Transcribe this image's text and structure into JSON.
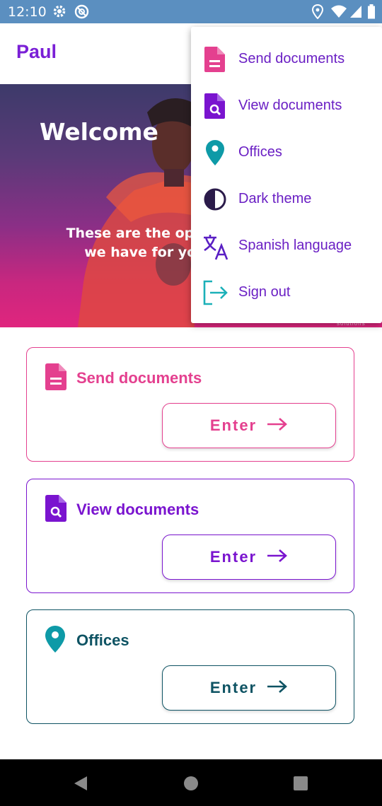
{
  "status_bar": {
    "time": "12:10"
  },
  "app_bar": {
    "user_name": "Paul"
  },
  "hero": {
    "welcome": "Welcome",
    "tagline_line1": "These are the option",
    "tagline_line2": "we have for you",
    "watermark": "solutions"
  },
  "cards": [
    {
      "title": "Send documents",
      "button": "Enter",
      "color": "#e4408f",
      "icon": "document-icon"
    },
    {
      "title": "View documents",
      "button": "Enter",
      "color": "#7a14cf",
      "icon": "document-search-icon"
    },
    {
      "title": "Offices",
      "button": "Enter",
      "color": "#0e5363",
      "icon": "location-pin-icon"
    }
  ],
  "menu": {
    "items": [
      {
        "label": "Send documents",
        "icon": "document-icon"
      },
      {
        "label": "View documents",
        "icon": "document-search-icon"
      },
      {
        "label": "Offices",
        "icon": "location-pin-icon"
      },
      {
        "label": "Dark theme",
        "icon": "contrast-icon"
      },
      {
        "label": "Spanish language",
        "icon": "translate-icon"
      },
      {
        "label": "Sign out",
        "icon": "sign-out-icon"
      }
    ]
  },
  "colors": {
    "status_bar": "#5b8fc0",
    "brand_purple": "#7a1fd6",
    "pink": "#e4408f",
    "teal": "#0e9aa7",
    "navy": "#0e5363"
  }
}
